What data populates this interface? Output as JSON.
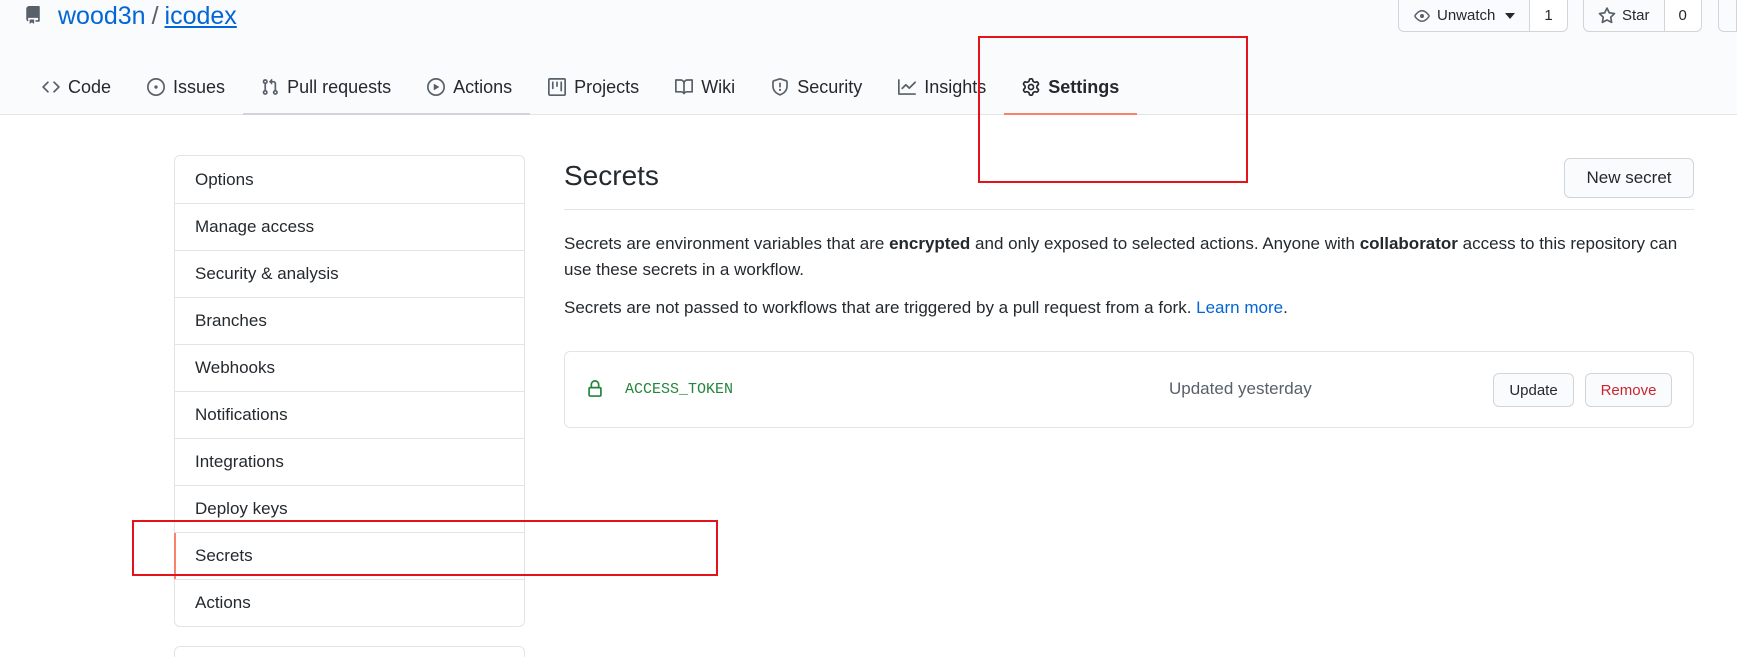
{
  "repo": {
    "owner": "wood3n",
    "separator": "/",
    "name": "icodex"
  },
  "header_buttons": {
    "watch_label": "Unwatch",
    "watch_count": "1",
    "star_label": "Star",
    "star_count": "0"
  },
  "tabs": [
    {
      "label": "Code",
      "icon": "code-icon"
    },
    {
      "label": "Issues",
      "icon": "issue-opened-icon"
    },
    {
      "label": "Pull requests",
      "icon": "git-pull-request-icon"
    },
    {
      "label": "Actions",
      "icon": "play-icon"
    },
    {
      "label": "Projects",
      "icon": "project-icon"
    },
    {
      "label": "Wiki",
      "icon": "book-icon"
    },
    {
      "label": "Security",
      "icon": "shield-icon"
    },
    {
      "label": "Insights",
      "icon": "graph-icon"
    },
    {
      "label": "Settings",
      "icon": "gear-icon",
      "selected": true
    }
  ],
  "sidebar": {
    "items": [
      {
        "label": "Options"
      },
      {
        "label": "Manage access"
      },
      {
        "label": "Security & analysis"
      },
      {
        "label": "Branches"
      },
      {
        "label": "Webhooks"
      },
      {
        "label": "Notifications"
      },
      {
        "label": "Integrations"
      },
      {
        "label": "Deploy keys"
      },
      {
        "label": "Secrets",
        "selected": true
      },
      {
        "label": "Actions"
      }
    ]
  },
  "main": {
    "title": "Secrets",
    "new_secret_label": "New secret",
    "desc1": {
      "part1": "Secrets are environment variables that are ",
      "bold1": "encrypted",
      "part2": " and only exposed to selected actions. Anyone with ",
      "bold2": "collaborator",
      "part3": " access to this repository can use these secrets in a workflow."
    },
    "desc2": {
      "text": "Secrets are not passed to workflows that are triggered by a pull request from a fork. ",
      "link": "Learn more",
      "end": "."
    },
    "secrets": [
      {
        "name": "ACCESS_TOKEN",
        "updated": "Updated yesterday",
        "update_label": "Update",
        "remove_label": "Remove"
      }
    ]
  },
  "colors": {
    "accent_underline": "#f9826c",
    "link": "#0366d6",
    "secret_green": "#22863a",
    "danger": "#cb2431",
    "annotation_red": "#e4131b"
  }
}
